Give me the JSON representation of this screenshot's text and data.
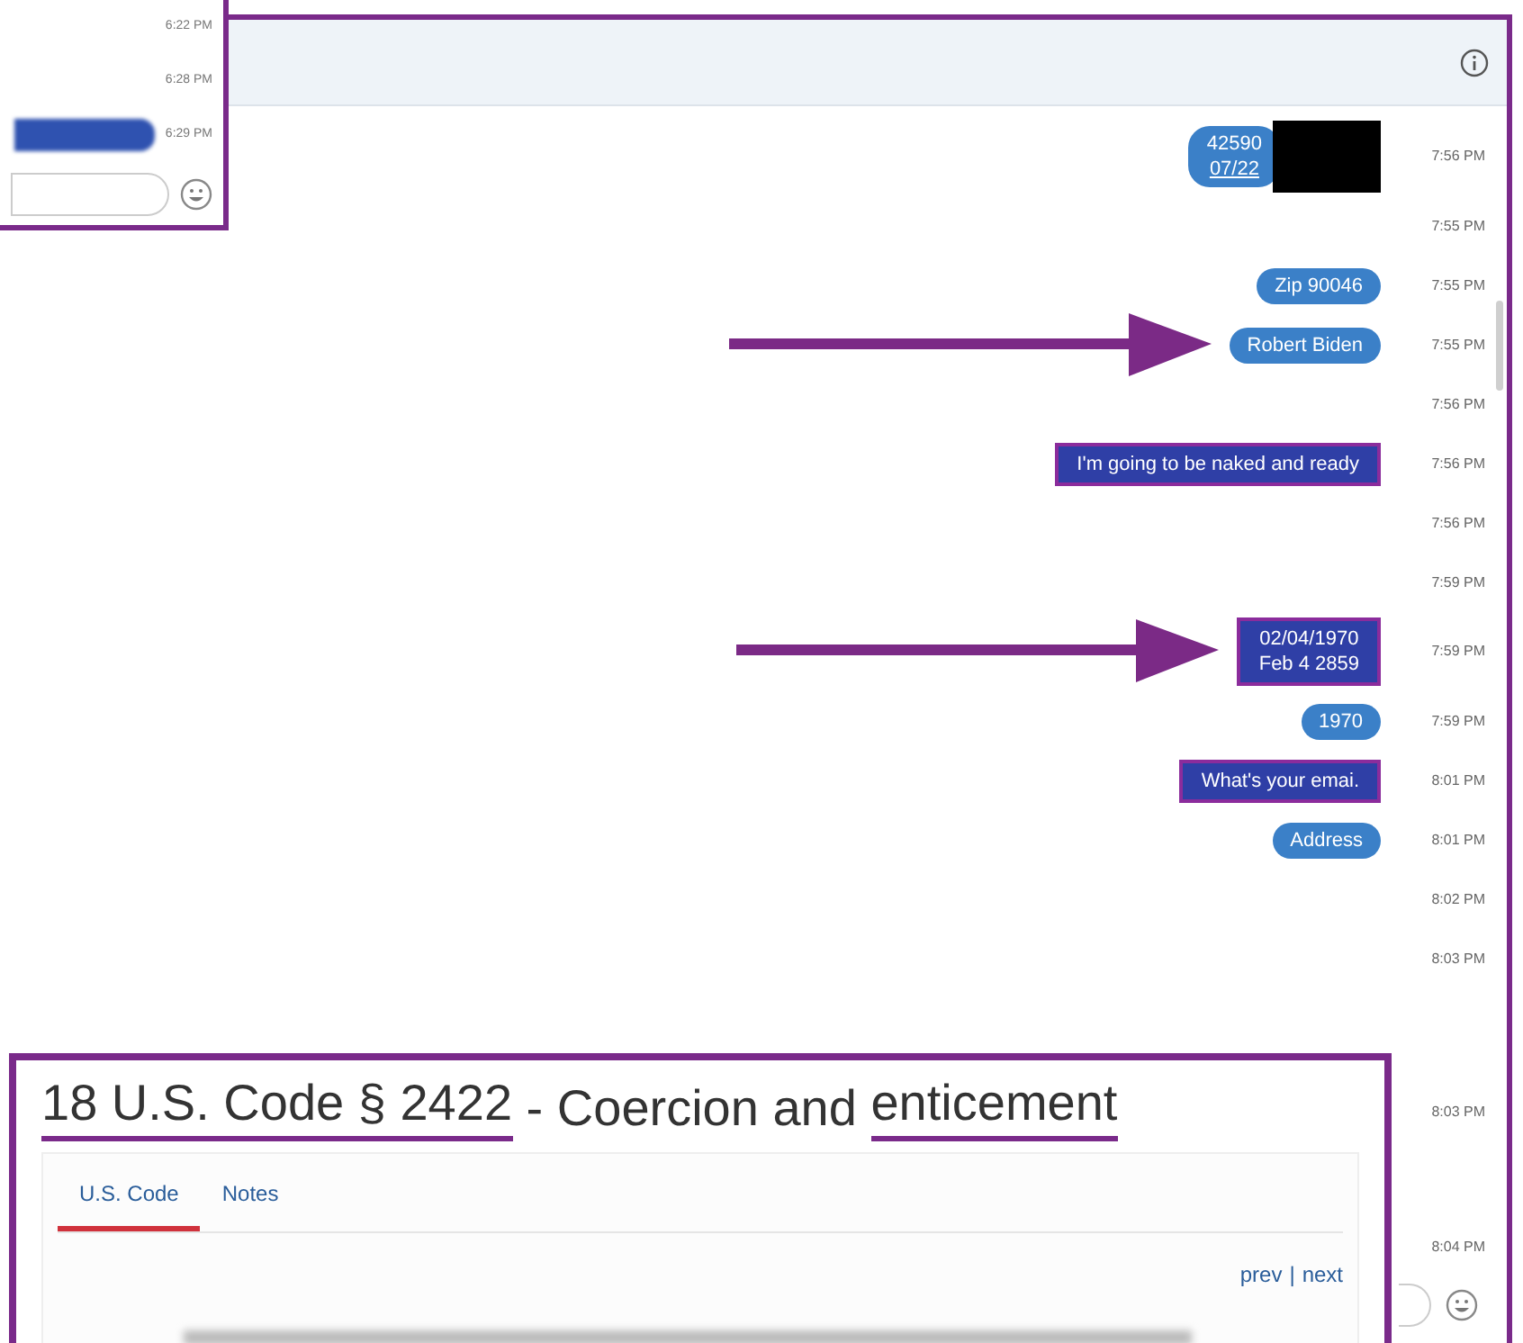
{
  "inset": {
    "times": [
      "6:22 PM",
      "6:28 PM",
      "6:29 PM"
    ]
  },
  "messages": [
    {
      "kind": "bubble",
      "lines": [
        "42590",
        "07/22"
      ],
      "redacted": true,
      "highlighted": false,
      "arrow": false,
      "time": "7:56 PM"
    },
    {
      "kind": "none",
      "time": "7:55 PM"
    },
    {
      "kind": "bubble",
      "lines": [
        "Zip 90046"
      ],
      "redacted": false,
      "highlighted": false,
      "arrow": false,
      "time": "7:55 PM"
    },
    {
      "kind": "bubble",
      "lines": [
        "Robert Biden"
      ],
      "redacted": false,
      "highlighted": false,
      "arrow": true,
      "time": "7:55 PM"
    },
    {
      "kind": "none",
      "time": "7:56 PM"
    },
    {
      "kind": "bubble",
      "lines": [
        "I'm going to be naked and ready"
      ],
      "redacted": false,
      "highlighted": true,
      "arrow": false,
      "time": "7:56 PM"
    },
    {
      "kind": "none",
      "time": "7:56 PM"
    },
    {
      "kind": "none",
      "time": "7:59 PM"
    },
    {
      "kind": "bubble",
      "lines": [
        "02/04/1970",
        "Feb 4 2859"
      ],
      "redacted": false,
      "highlighted": true,
      "arrow": true,
      "time": "7:59 PM"
    },
    {
      "kind": "bubble",
      "lines": [
        "1970"
      ],
      "redacted": false,
      "highlighted": false,
      "arrow": false,
      "time": "7:59 PM"
    },
    {
      "kind": "bubble",
      "lines": [
        "What's your emai."
      ],
      "redacted": false,
      "highlighted": true,
      "arrow": false,
      "time": "8:01 PM"
    },
    {
      "kind": "bubble",
      "lines": [
        "Address"
      ],
      "redacted": false,
      "highlighted": false,
      "arrow": false,
      "time": "8:01 PM"
    },
    {
      "kind": "none",
      "time": "8:02 PM"
    },
    {
      "kind": "none",
      "time": "8:03 PM"
    }
  ],
  "later_times": [
    "8:03 PM",
    "8:04 PM"
  ],
  "article": {
    "title_code": "18 U.S. Code § 2422",
    "title_sep": " - Coercion and ",
    "title_word": "enticement",
    "tabs": [
      {
        "label": "U.S. Code",
        "selected": true
      },
      {
        "label": "Notes",
        "selected": false
      }
    ],
    "nav": [
      "prev",
      "|",
      "next"
    ]
  }
}
